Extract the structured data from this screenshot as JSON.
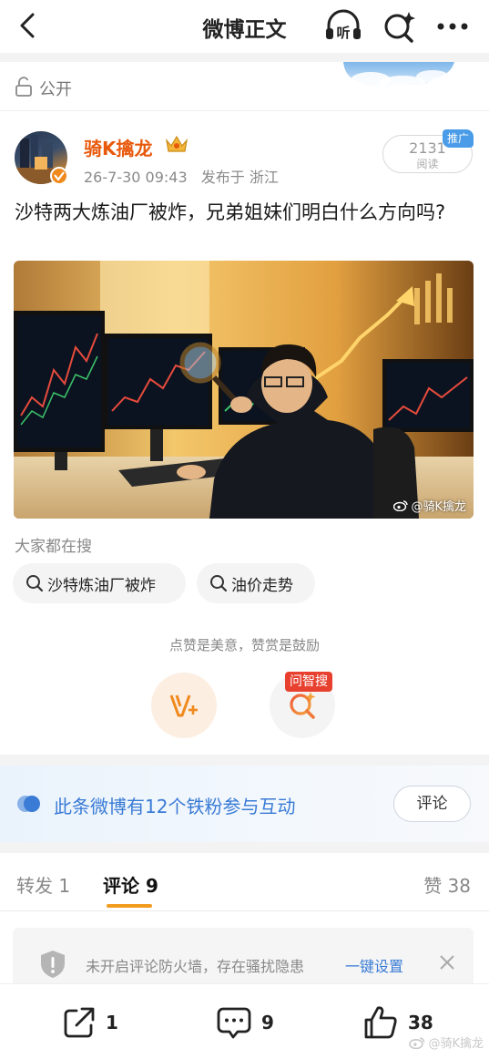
{
  "nav": {
    "title": "微博正文",
    "listen_label": "听"
  },
  "visibility": {
    "label": "公开"
  },
  "author": {
    "name": "骑K擒龙",
    "time": "26-7-30 09:43",
    "location": "发布于 浙江",
    "read_count": "2131",
    "read_label": "阅读",
    "promo_tag": "推广"
  },
  "post": {
    "text": "沙特两大炼油厂被炸，兄弟姐妹们明白什么方向吗?",
    "watermark": "@骑K擒龙"
  },
  "suggestions": {
    "title": "大家都在搜",
    "items": [
      {
        "label": "沙特炼油厂被炸"
      },
      {
        "label": "油价走势"
      }
    ]
  },
  "reward": {
    "hint": "点赞是美意，赞赏是鼓励",
    "ai_tag": "问智搜"
  },
  "fans": {
    "text": "此条微博有12个铁粉参与互动",
    "button": "评论"
  },
  "tabs": {
    "repost": "转发 1",
    "comment": "评论 9",
    "like": "赞 38"
  },
  "firewall": {
    "text": "未开启评论防火墙，存在骚扰隐患",
    "link": "一键设置"
  },
  "bottombar": {
    "repost_count": "1",
    "comment_count": "9",
    "like_count": "38",
    "watermark": "@骑K擒龙"
  },
  "colors": {
    "accent_orange": "#f29b1f",
    "author_name": "#e8590c",
    "link_blue": "#3a7bd5",
    "ai_tag_red": "#e8402f"
  }
}
